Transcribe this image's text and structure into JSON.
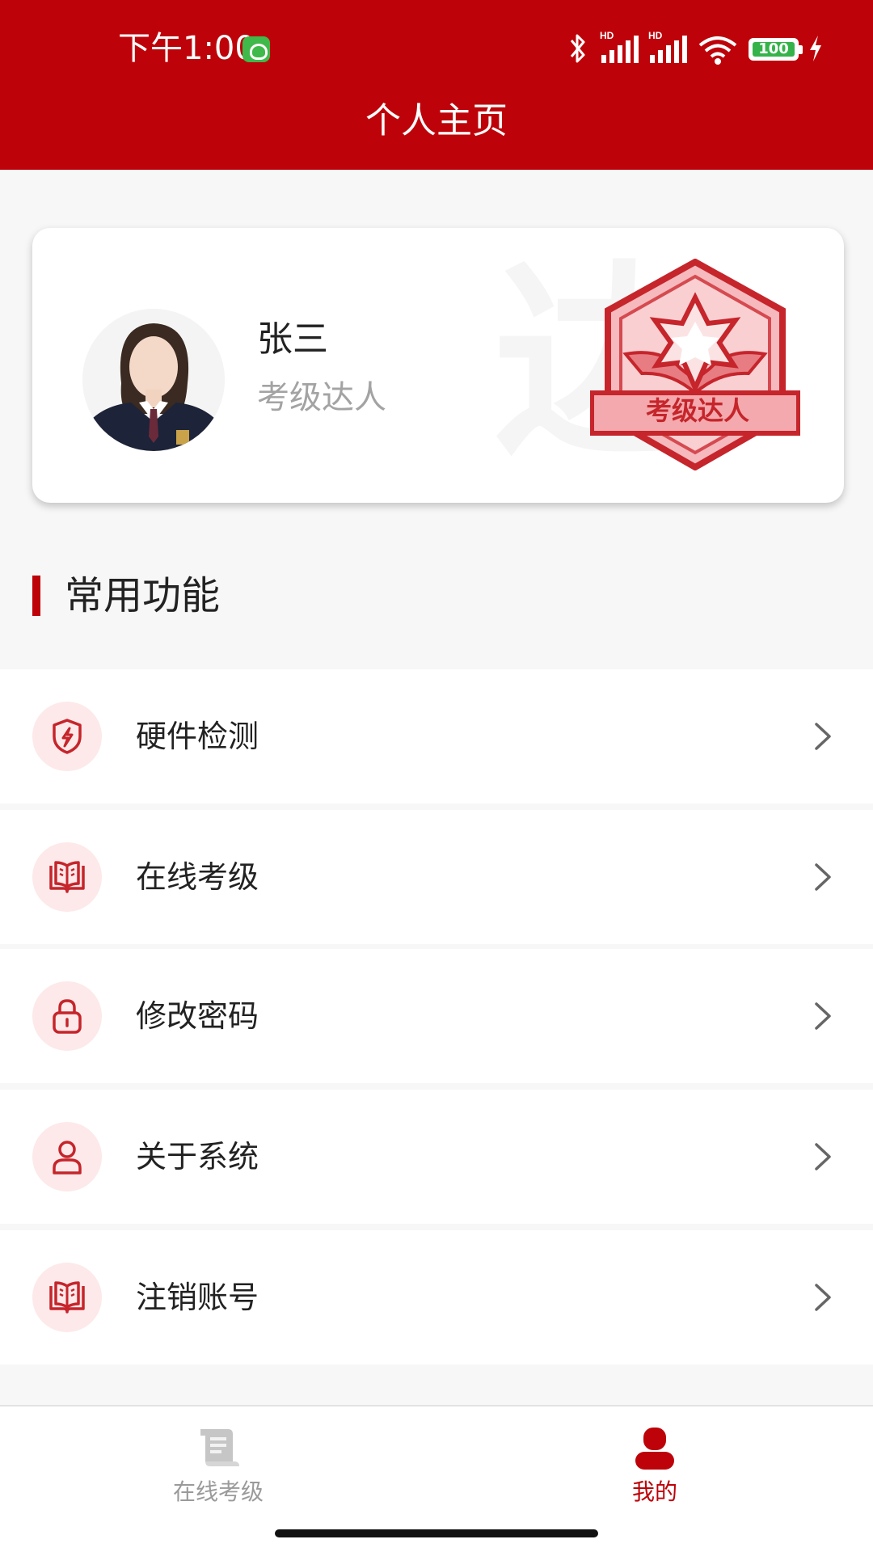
{
  "status_bar": {
    "time": "下午1:00",
    "network_label_1": "HD",
    "network_label_2": "HD",
    "battery_level": "100"
  },
  "header": {
    "title": "个人主页"
  },
  "profile": {
    "name": "张三",
    "title": "考级达人",
    "badge_label": "考级达人",
    "watermark_text": "达人"
  },
  "section": {
    "title": "常用功能"
  },
  "menu": {
    "items": [
      {
        "label": "硬件检测",
        "icon": "shield-lightning-icon"
      },
      {
        "label": "在线考级",
        "icon": "book-open-icon"
      },
      {
        "label": "修改密码",
        "icon": "lock-icon"
      },
      {
        "label": "关于系统",
        "icon": "user-icon"
      },
      {
        "label": "注销账号",
        "icon": "book-open-icon"
      }
    ]
  },
  "tab_bar": {
    "tabs": [
      {
        "label": "在线考级",
        "icon": "scroll-icon",
        "active": false
      },
      {
        "label": "我的",
        "icon": "profile-icon",
        "active": true
      }
    ]
  },
  "colors": {
    "brand_red": "#bd0309",
    "icon_bg": "#fde9ea",
    "active_tab": "#bd0309",
    "inactive_tab": "#9a9a9a"
  }
}
